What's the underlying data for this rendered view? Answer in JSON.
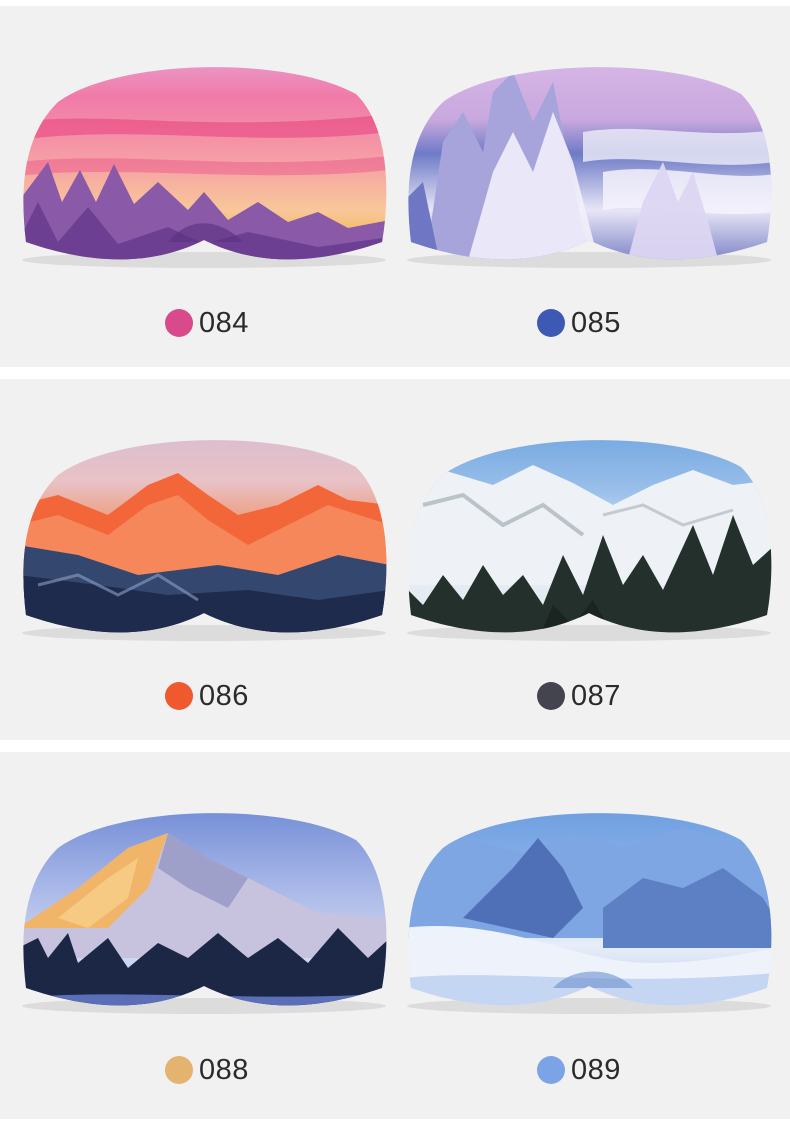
{
  "variants": [
    {
      "code": "084",
      "swatch": "#d94a8c",
      "design": "pink-sunset-forest"
    },
    {
      "code": "085",
      "swatch": "#3d59b4",
      "design": "snowy-trees-sea-of-clouds"
    },
    {
      "code": "086",
      "swatch": "#ee5a2e",
      "design": "alpenglow-peaks"
    },
    {
      "code": "087",
      "swatch": "#44444e",
      "design": "alpine-valley-pines"
    },
    {
      "code": "088",
      "swatch": "#e3b36f",
      "design": "golden-mountain-forest"
    },
    {
      "code": "089",
      "swatch": "#7ca3e6",
      "design": "blue-snow-mountains"
    }
  ]
}
